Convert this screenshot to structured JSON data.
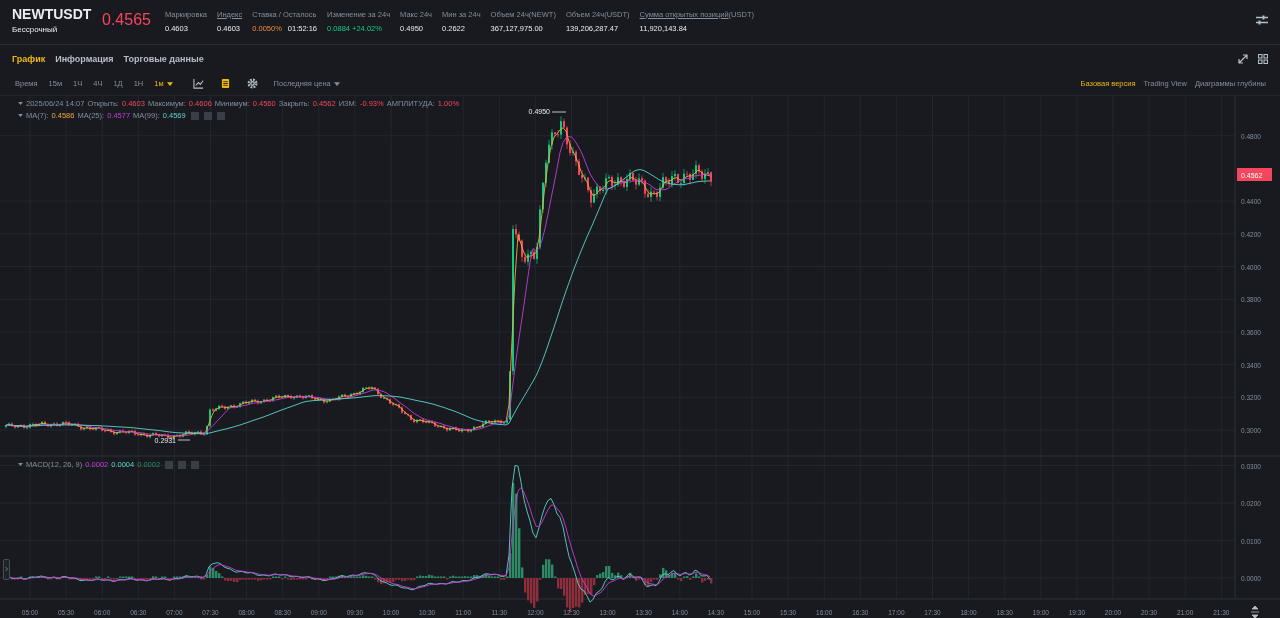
{
  "header": {
    "symbol": "NEWTUSDT",
    "contract_type": "Бессрочный",
    "last_price": "0.4565",
    "stats": [
      {
        "label": "Маркировка",
        "underlined": false,
        "values": [
          {
            "text": "0.4603",
            "kind": "plain"
          }
        ]
      },
      {
        "label": "Индекс",
        "underlined": true,
        "values": [
          {
            "text": "0.4603",
            "kind": "plain"
          }
        ]
      },
      {
        "label": "Ставка / Осталось",
        "underlined": false,
        "values": [
          {
            "text": "0.0050%",
            "kind": "funding"
          },
          {
            "text": "01:52:16",
            "kind": "plain"
          }
        ]
      },
      {
        "label": "Изменение за 24ч",
        "underlined": false,
        "values": [
          {
            "text": "0.0884 +24.02%",
            "kind": "up"
          }
        ]
      },
      {
        "label": "Макс 24ч",
        "underlined": false,
        "values": [
          {
            "text": "0.4950",
            "kind": "plain"
          }
        ]
      },
      {
        "label": "Мин за 24ч",
        "underlined": false,
        "values": [
          {
            "text": "0.2622",
            "kind": "plain"
          }
        ]
      },
      {
        "label": "Объем 24ч(NEWT)",
        "underlined": false,
        "values": [
          {
            "text": "367,127,975.00",
            "kind": "plain"
          }
        ]
      },
      {
        "label": "Объем 24ч(USDT)",
        "underlined": false,
        "values": [
          {
            "text": "139,206,287.47",
            "kind": "plain"
          }
        ]
      },
      {
        "label": "Сумма открытых позиций",
        "suffix": "(USDT)",
        "underlined": true,
        "values": [
          {
            "text": "11,920,143.84",
            "kind": "plain"
          }
        ]
      }
    ]
  },
  "tabs": [
    {
      "label": "График",
      "selected": true
    },
    {
      "label": "Информация",
      "selected": false
    },
    {
      "label": "Торговые данные",
      "selected": false
    }
  ],
  "toolbar": {
    "time_label": "Время",
    "intervals": [
      {
        "label": "15м",
        "selected": false
      },
      {
        "label": "1Ч",
        "selected": false
      },
      {
        "label": "4Ч",
        "selected": false
      },
      {
        "label": "1Д",
        "selected": false
      },
      {
        "label": "1Н",
        "selected": false
      },
      {
        "label": "1м",
        "selected": true
      }
    ],
    "price_source": "Последняя цена",
    "views": [
      {
        "label": "Базовая версия",
        "selected": true
      },
      {
        "label": "Trading View",
        "selected": false
      },
      {
        "label": "Диаграммы глубины",
        "selected": false
      }
    ]
  },
  "legend": {
    "date": "2025/06/24 14:07",
    "fields": [
      {
        "label": "Открыть:",
        "value": "0.4603"
      },
      {
        "label": "Максимум:",
        "value": "0.4606"
      },
      {
        "label": "Минимум:",
        "value": "0.4560"
      },
      {
        "label": "Закрыть:",
        "value": "0.4562"
      },
      {
        "label": "ИЗМ:",
        "value": "-0.93%"
      },
      {
        "label": "АМПЛИТУДА:",
        "value": "1.00%"
      }
    ],
    "ma": [
      {
        "label": "MA(7):",
        "value": "0.4586"
      },
      {
        "label": "MA(25):",
        "value": "0.4577"
      },
      {
        "label": "MA(99):",
        "value": "0.4569"
      }
    ]
  },
  "macd": {
    "label": "MACD(12, 26, 9)",
    "values": [
      "0.0002",
      "0.0004",
      "0.0002"
    ]
  },
  "price_axis": {
    "ticks": [
      "0.4800",
      "0.4400",
      "0.4200",
      "0.4000",
      "0.3800",
      "0.3600",
      "0.3400",
      "0.3200",
      "0.3000"
    ],
    "current_price": "0.4562",
    "high_mark": "0.4950",
    "low_mark": "0.2931"
  },
  "macd_axis": {
    "ticks": [
      "0.0300",
      "0.0200",
      "0.0100",
      "0.0000"
    ]
  },
  "time_axis": [
    "05:00",
    "05:30",
    "06:00",
    "06:30",
    "07:00",
    "07:30",
    "08:00",
    "08:30",
    "09:00",
    "09:30",
    "10:00",
    "10:30",
    "11:00",
    "11:30",
    "12:00",
    "12:30",
    "13:00",
    "13:30",
    "14:00",
    "14:30",
    "15:00",
    "15:30",
    "16:00",
    "16:30",
    "17:00",
    "17:30",
    "18:00",
    "18:30",
    "19:00",
    "19:30",
    "20:00",
    "20:30",
    "21:00",
    "21:30"
  ]
}
